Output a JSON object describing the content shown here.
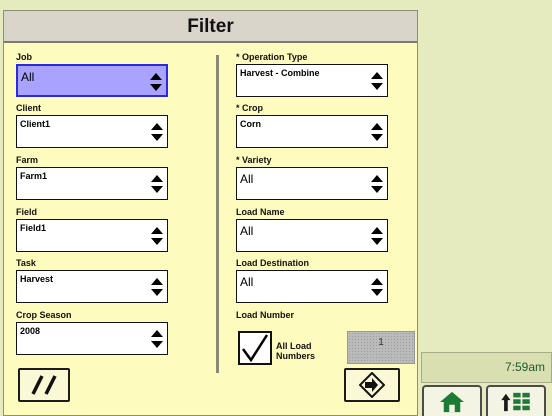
{
  "dialog": {
    "title": "Filter",
    "left_fields": [
      {
        "label": "Job",
        "value": "All"
      },
      {
        "label": "Client",
        "value": "Client1"
      },
      {
        "label": "Farm",
        "value": "Farm1"
      },
      {
        "label": "Field",
        "value": "Field1"
      },
      {
        "label": "Task",
        "value": "Harvest"
      },
      {
        "label": "Crop Season",
        "value": "2008"
      }
    ],
    "right_fields": [
      {
        "label": "* Operation Type",
        "value": "Harvest - Combine"
      },
      {
        "label": "* Crop",
        "value": "Corn"
      },
      {
        "label": "* Variety",
        "value": "All"
      },
      {
        "label": "Load Name",
        "value": "All"
      },
      {
        "label": "Load Destination",
        "value": "All"
      }
    ],
    "load_number": {
      "label": "Load Number",
      "checkbox_label_line1": "All Load",
      "checkbox_label_line2": "Numbers",
      "value": "1"
    }
  },
  "status": {
    "time": "7:59am"
  },
  "icons": {
    "cancel": "double-slash-icon",
    "next": "arrow-right-icon",
    "home": "home-icon",
    "menu": "up-arrow-grid-icon"
  },
  "colors": {
    "panel": "#fdfbbe",
    "selected": "#a9a3ff",
    "time": "#1b5d2c"
  }
}
